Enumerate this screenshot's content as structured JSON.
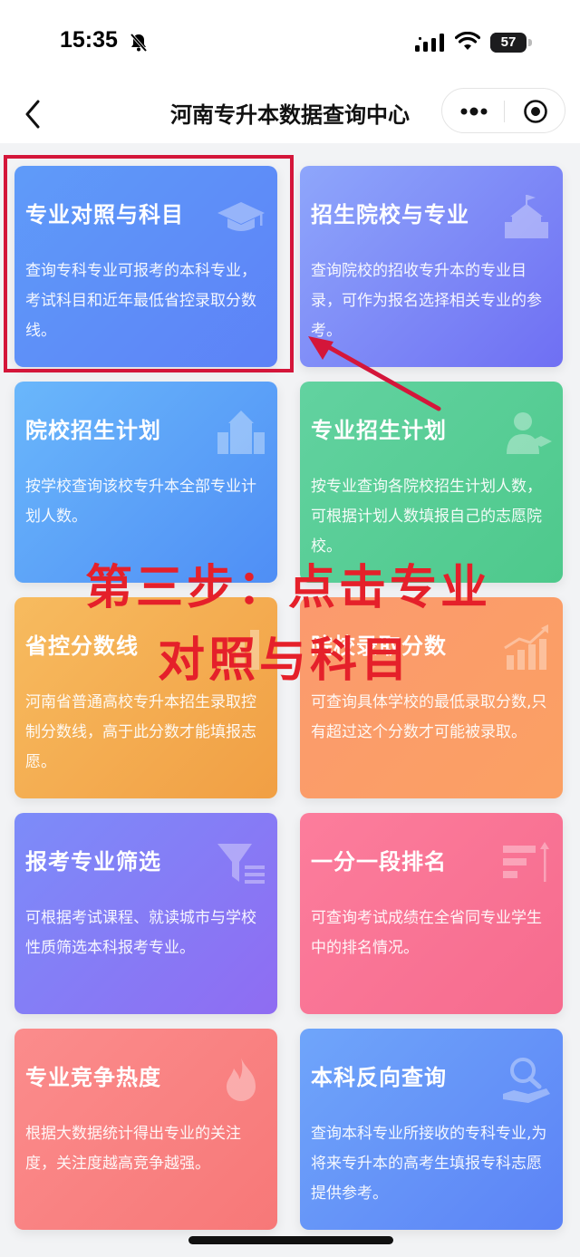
{
  "status": {
    "time": "15:35",
    "battery": "57",
    "battery_level": 0.57
  },
  "nav": {
    "title": "河南专升本数据查询中心"
  },
  "cards": [
    {
      "title": "专业对照与科目",
      "desc": "查询专科专业可报考的本科专业，考试科目和近年最低省控录取分数线。",
      "icon": "graduation-cap-icon"
    },
    {
      "title": "招生院校与专业",
      "desc": "查询院校的招收专升本的专业目录，可作为报名选择相关专业的参考。",
      "icon": "school-building-icon"
    },
    {
      "title": "院校招生计划",
      "desc": "按学校查询该校专升本全部专业计划人数。",
      "icon": "campus-icon"
    },
    {
      "title": "专业招生计划",
      "desc": "按专业查询各院校招生计划人数，可根据计划人数填报自己的志愿院校。",
      "icon": "graduate-person-icon"
    },
    {
      "title": "省控分数线",
      "desc": "河南省普通高校专升本招生录取控制分数线，高于此分数才能填报志愿。",
      "icon": "bar-chart-icon"
    },
    {
      "title": "院校录取分数",
      "desc": "可查询具体学校的最低录取分数,只有超过这个分数才可能被录取。",
      "icon": "trend-chart-icon"
    },
    {
      "title": "报考专业筛选",
      "desc": "可根据考试课程、就读城市与学校性质筛选本科报考专业。",
      "icon": "filter-icon"
    },
    {
      "title": "一分一段排名",
      "desc": "可查询考试成绩在全省同专业学生中的排名情况。",
      "icon": "ranking-icon"
    },
    {
      "title": "专业竞争热度",
      "desc": "根据大数据统计得出专业的关注度，关注度越高竞争越强。",
      "icon": "flame-icon"
    },
    {
      "title": "本科反向查询",
      "desc": "查询本科专业所接收的专科专业,为将来专升本的高考生填报专科志愿提供参考。",
      "icon": "magnifier-hand-icon"
    }
  ],
  "annotation": {
    "line1": "第三步：点击专业",
    "line2": "对照与科目"
  },
  "colors": {
    "highlight": "#d4163a",
    "annotation": "#e5202a"
  }
}
